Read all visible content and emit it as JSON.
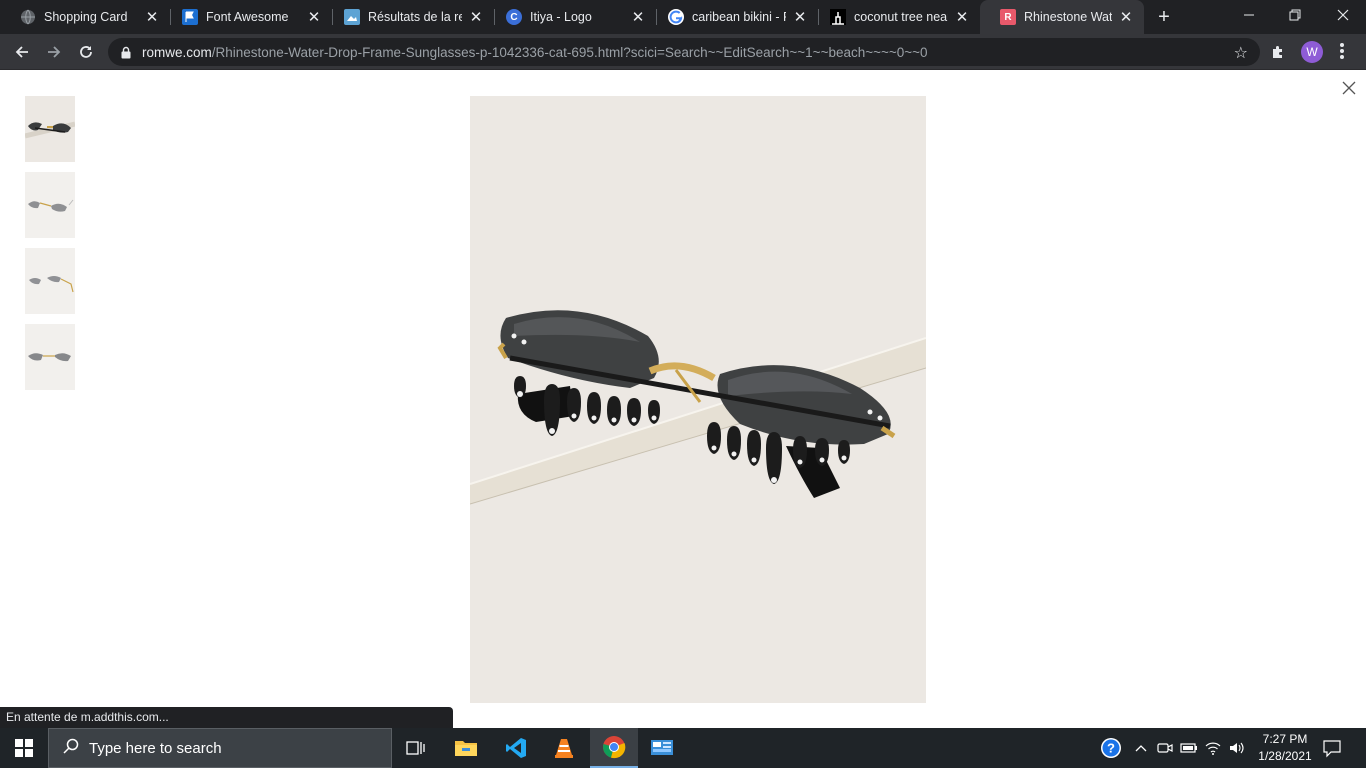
{
  "browser": {
    "tabs": [
      {
        "title": "Shopping Card",
        "favicon": "globe-icon",
        "active": false
      },
      {
        "title": "Font Awesome",
        "favicon": "flag-icon",
        "active": false
      },
      {
        "title": "Résultats de la recl",
        "favicon": "image-icon",
        "active": false
      },
      {
        "title": "Itiya - Logo",
        "favicon": "c-logo-icon",
        "active": false
      },
      {
        "title": "caribean bikini - Re",
        "favicon": "google-icon",
        "active": false
      },
      {
        "title": "coconut tree near",
        "favicon": "coconut-icon",
        "active": false
      },
      {
        "title": "Rhinestone Water",
        "favicon": "romwe-icon",
        "active": true
      }
    ],
    "url_host": "romwe.com",
    "url_path": "/Rhinestone-Water-Drop-Frame-Sunglasses-p-1042336-cat-695.html?scici=Search~~EditSearch~~1~~beach~~~~0~~0",
    "profile_initial": "W",
    "status_text": "En attente de m.addthis.com..."
  },
  "viewer": {
    "thumbnails": [
      {
        "name": "thumbnail-1",
        "selected": true
      },
      {
        "name": "thumbnail-2",
        "selected": false
      },
      {
        "name": "thumbnail-3",
        "selected": false
      },
      {
        "name": "thumbnail-4",
        "selected": false
      }
    ],
    "main_image": "rhinestone-water-drop-sunglasses-photo"
  },
  "taskbar": {
    "search_placeholder": "Type here to search",
    "time": "7:27 PM",
    "date": "1/28/2021",
    "apps": [
      "task-view-icon",
      "file-explorer-icon",
      "vscode-icon",
      "vlc-icon",
      "chrome-icon",
      "control-panel-icon"
    ]
  },
  "colors": {
    "tabstrip": "#202124",
    "toolbar": "#35363a",
    "taskbar": "#1f2428",
    "accent": "#77b0e6",
    "romwe": "#e8596b"
  }
}
